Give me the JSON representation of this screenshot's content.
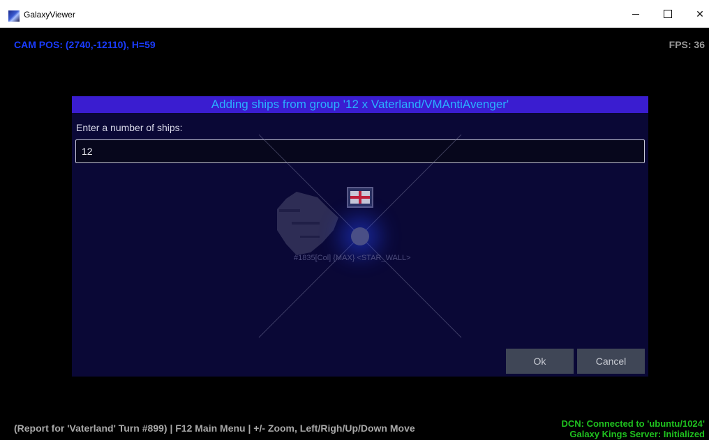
{
  "window": {
    "title": "GalaxyViewer",
    "minimize_glyph": "—",
    "maximize_glyph": "☐",
    "close_glyph": "✕"
  },
  "hud": {
    "cam_pos": "CAM POS: (2740,-12110), H=59",
    "fps": "FPS: 36"
  },
  "scene": {
    "ship_label": "#1835[Col] {MAX} <STAR_WALL>"
  },
  "dialog": {
    "title": "Adding ships from group '12 x Vaterland/VMAntiAvenger'",
    "prompt": "Enter a number of ships:",
    "input_value": "12",
    "ok_label": "Ok",
    "cancel_label": "Cancel"
  },
  "status": {
    "left": "(Report for 'Vaterland' Turn #899) | F12 Main Menu | +/- Zoom, Left/Righ/Up/Down Move",
    "right_line1": "DCN: Connected to 'ubuntu/1024'",
    "right_line2": "Galaxy Kings Server: Initialized"
  },
  "colors": {
    "dialog_header": "#3a1dd0",
    "dialog_title_text": "#2ab0ff",
    "cam_pos": "#1a3cff",
    "status_ok": "#1fc21f"
  },
  "icons": {
    "app": "galaxy-app-icon",
    "flag": "flag-icon",
    "star": "star-icon"
  }
}
